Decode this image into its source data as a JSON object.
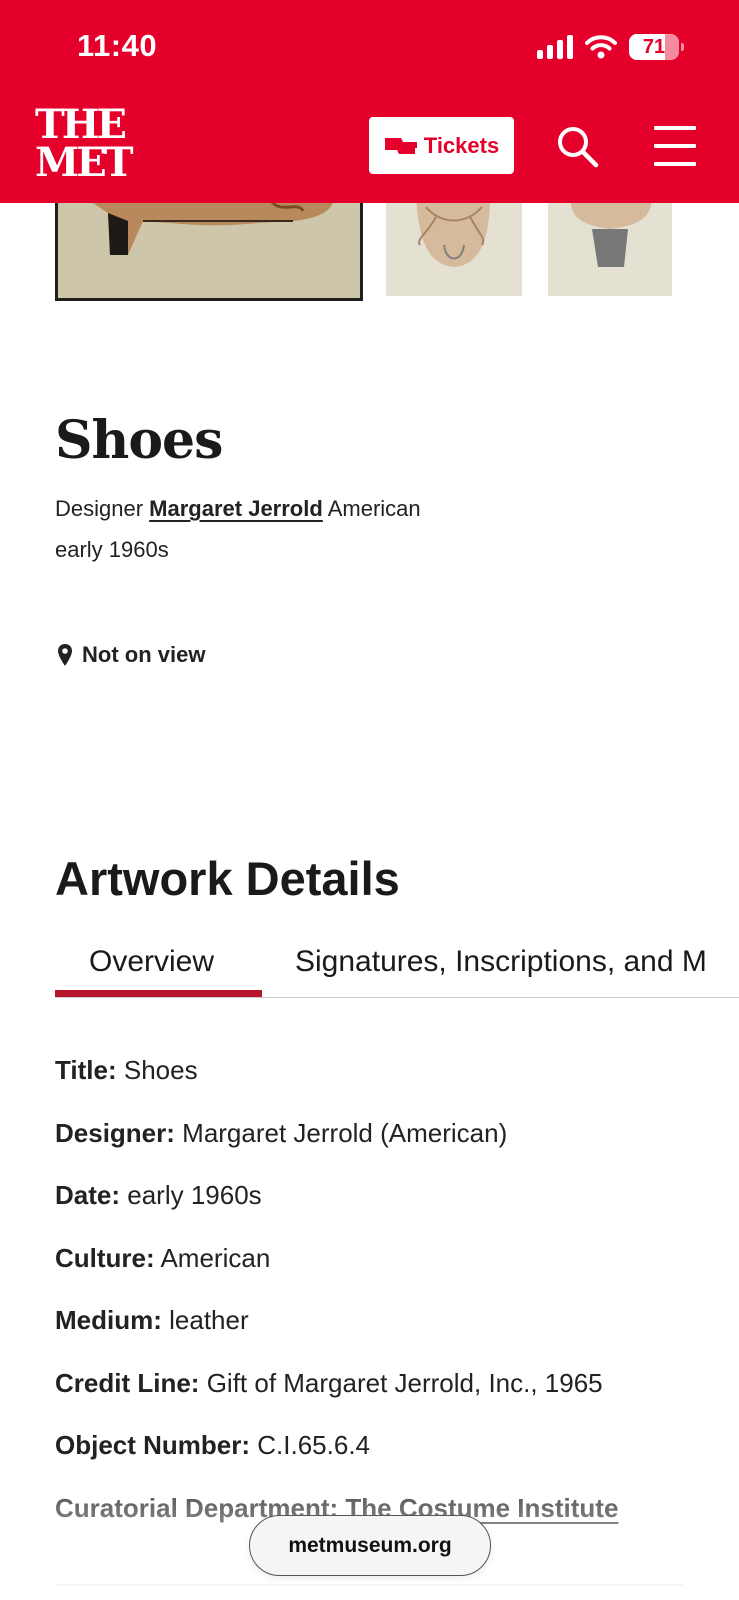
{
  "status_bar": {
    "time": "11:40",
    "battery": "71"
  },
  "header": {
    "logo_line1": "THE",
    "logo_line2": "MET",
    "tickets_label": "Tickets",
    "search_icon": "search-icon",
    "menu_icon": "hamburger-menu-icon",
    "brand_color": "#e4002b"
  },
  "object": {
    "title": "Shoes",
    "designer_role": "Designer",
    "designer_name": "Margaret Jerrold",
    "nationality": "American",
    "date": "early 1960s",
    "location_status": "Not on view"
  },
  "artwork_details": {
    "heading": "Artwork Details",
    "tabs": [
      "Overview",
      "Signatures, Inscriptions, and M"
    ],
    "active_tab": "Overview",
    "fields": [
      {
        "label": "Title:",
        "value": "Shoes"
      },
      {
        "label": "Designer:",
        "value": "Margaret Jerrold (American)"
      },
      {
        "label": "Date:",
        "value": "early 1960s"
      },
      {
        "label": "Culture:",
        "value": "American"
      },
      {
        "label": "Medium:",
        "value": "leather"
      },
      {
        "label": "Credit Line:",
        "value": "Gift of Margaret Jerrold, Inc., 1965"
      },
      {
        "label": "Object Number:",
        "value": "C.I.65.6.4"
      },
      {
        "label": "Curatorial Department:",
        "value": "The Costume Institute"
      }
    ]
  },
  "browser": {
    "url": "metmuseum.org"
  }
}
